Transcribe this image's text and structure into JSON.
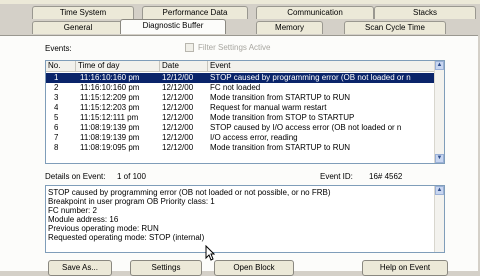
{
  "tabs_row1": [
    "Time System",
    "Performance Data",
    "Communication",
    "Stacks"
  ],
  "tabs_row2": [
    "General",
    "Diagnostic Buffer",
    "Memory",
    "Scan Cycle Time"
  ],
  "active_tab": "Diagnostic Buffer",
  "events_label": "Events:",
  "filter_label": "Filter Settings Active",
  "columns": [
    "No.",
    "Time of day",
    "Date",
    "Event"
  ],
  "events": [
    {
      "no": "1",
      "time": "11:16:10:160 pm",
      "date": "12/12/00",
      "event": "STOP caused by programming error (OB not loaded or n"
    },
    {
      "no": "2",
      "time": "11:16:10:160 pm",
      "date": "12/12/00",
      "event": "FC not loaded"
    },
    {
      "no": "3",
      "time": "11:15:12:209 pm",
      "date": "12/12/00",
      "event": "Mode transition from STARTUP to RUN"
    },
    {
      "no": "4",
      "time": "11:15:12:203 pm",
      "date": "12/12/00",
      "event": "Request for manual warm restart"
    },
    {
      "no": "5",
      "time": "11:15:12:111 pm",
      "date": "12/12/00",
      "event": "Mode transition from STOP to STARTUP"
    },
    {
      "no": "6",
      "time": "11:08:19:139 pm",
      "date": "12/12/00",
      "event": "STOP caused by I/O access error (OB not loaded or n"
    },
    {
      "no": "7",
      "time": "11:08:19:139 pm",
      "date": "12/12/00",
      "event": "I/O access error, reading"
    },
    {
      "no": "8",
      "time": "11:08:19:095 pm",
      "date": "12/12/00",
      "event": "Mode transition from STARTUP to RUN"
    }
  ],
  "details_label": "Details on Event:",
  "details_count": "1 of 100",
  "event_id_label": "Event ID:",
  "event_id_value": "16# 4562",
  "detail_lines": [
    "STOP caused by programming error (OB not loaded or not possible, or no FRB)",
    "Breakpoint in user program OB   Priority class:   1",
    "FC number:     2",
    "Module address:     16",
    "Previous operating mode: RUN",
    "Requested operating mode: STOP (internal)"
  ],
  "buttons": [
    "Save As...",
    "Settings",
    "Open Block",
    "Help on Event"
  ],
  "colors": {
    "selection": "#0a246a",
    "dialog": "#d4d0c8",
    "tab": "#ece9d8"
  }
}
